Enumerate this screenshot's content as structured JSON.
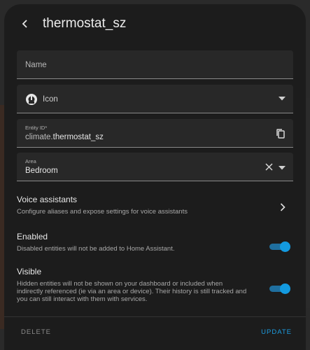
{
  "dialog": {
    "title": "thermostat_sz"
  },
  "form": {
    "name": {
      "label": "Name",
      "value": ""
    },
    "icon": {
      "label": "Icon"
    },
    "entity_id": {
      "label": "Entity ID*",
      "prefix": "climate.",
      "value": "thermostat_sz"
    },
    "area": {
      "label": "Area",
      "value": "Bedroom"
    }
  },
  "voice_assistants": {
    "title": "Voice assistants",
    "description": "Configure aliases and expose settings for voice assistants"
  },
  "enabled": {
    "title": "Enabled",
    "description": "Disabled entities will not be added to Home Assistant.",
    "on": true
  },
  "visible": {
    "title": "Visible",
    "description": "Hidden entities will not be shown on your dashboard or included when indirectly referenced (ie via an area or device). Their history is still tracked and you can still interact with them with services.",
    "on": true
  },
  "footer": {
    "delete_label": "DELETE",
    "update_label": "UPDATE"
  },
  "colors": {
    "accent": "#139ae0",
    "surface": "#1c1c1c",
    "field": "#282828"
  }
}
